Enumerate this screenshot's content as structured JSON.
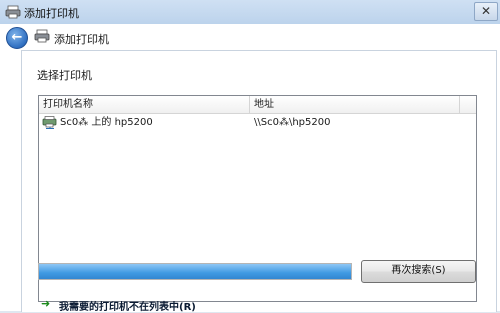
{
  "window": {
    "title": "添加打印机",
    "close_glyph": "✕"
  },
  "nav": {
    "back_glyph": "⮌",
    "title": "添加打印机"
  },
  "content": {
    "instruction": "选择打印机",
    "list": {
      "columns": [
        "打印机名称",
        "地址"
      ],
      "rows": [
        {
          "icon": "network-printer-icon",
          "name": "Sc0⁂ 上的 hp5200",
          "address": "\\\\Sc0⁂\\hp5200"
        }
      ]
    },
    "progress": {
      "value_percent": 100
    },
    "search_button": "再次搜索(S)",
    "not_listed_link": "我需要的打印机不在列表中(R)"
  },
  "colors": {
    "accent_blue": "#3f9ae2",
    "link_green": "#1c8a1c",
    "titlebar": "#cfe0f3"
  }
}
